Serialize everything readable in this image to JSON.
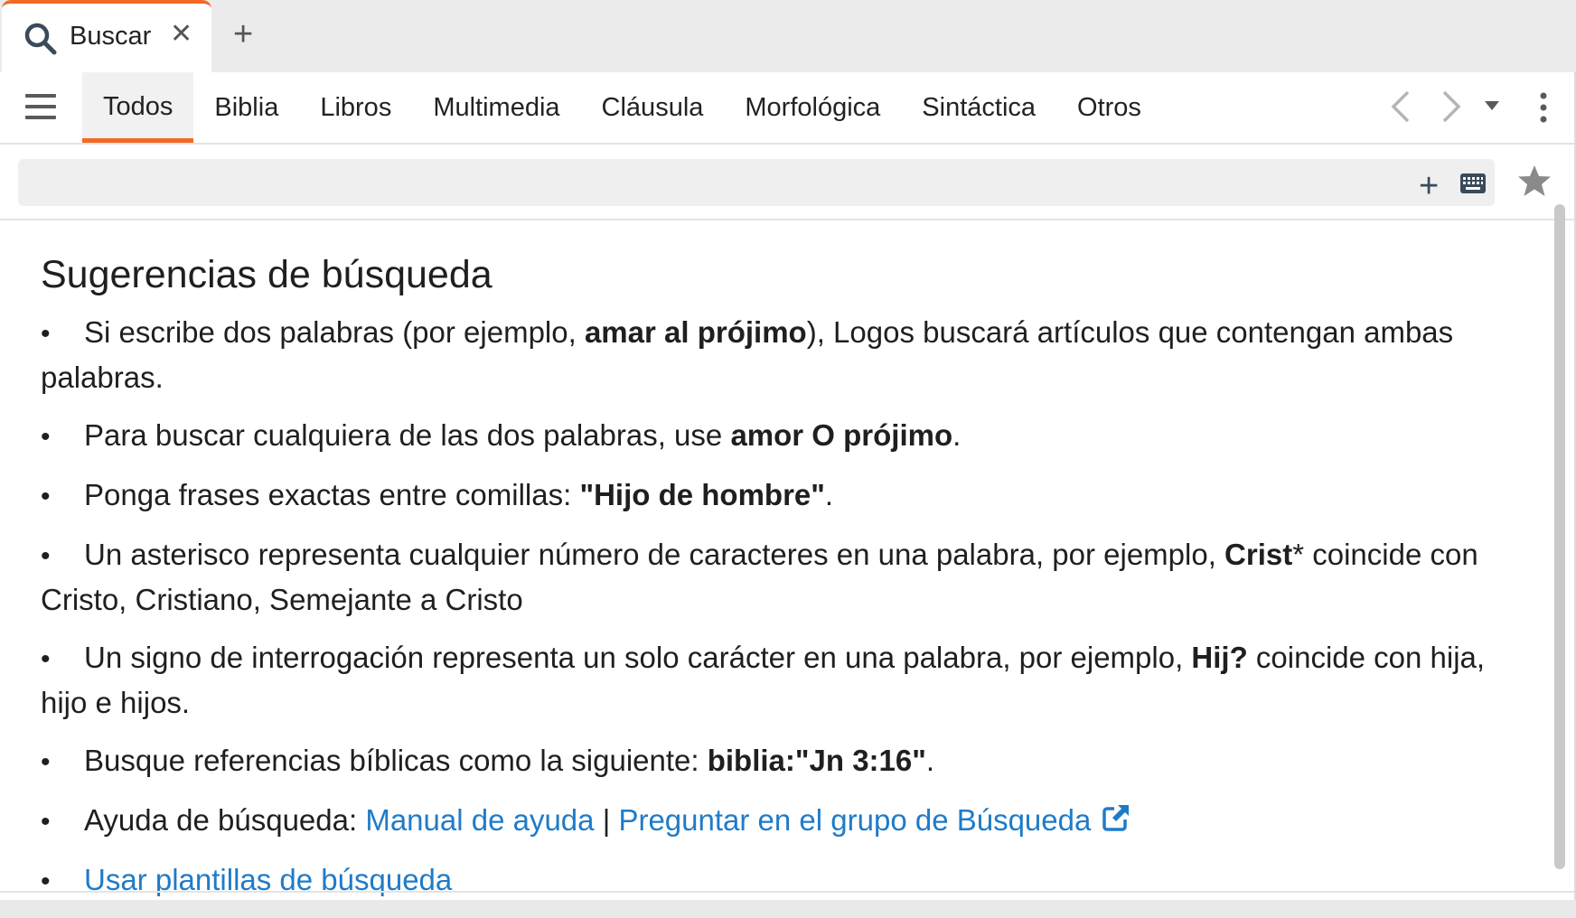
{
  "tab": {
    "title": "Buscar",
    "close": "✕",
    "new_tab": "+"
  },
  "nav": {
    "tabs": [
      {
        "label": "Todos"
      },
      {
        "label": "Biblia"
      },
      {
        "label": "Libros"
      },
      {
        "label": "Multimedia"
      },
      {
        "label": "Cláusula"
      },
      {
        "label": "Morfológica"
      },
      {
        "label": "Sintáctica"
      },
      {
        "label": "Otros"
      }
    ],
    "active_tab": "Todos"
  },
  "search": {
    "value": "",
    "add": "+"
  },
  "content": {
    "heading": "Sugerencias de búsqueda",
    "bullet": "•",
    "tip1": {
      "a": "Si escribe dos palabras (por ejemplo, ",
      "b": "amar al prójimo",
      "c": "), Logos buscará artículos que contengan ambas palabras."
    },
    "tip2": {
      "a": "Para buscar cualquiera de las dos palabras, use ",
      "b": "amor O prójimo",
      "c": "."
    },
    "tip3": {
      "a": "Ponga frases exactas entre comillas: ",
      "b": "\"Hijo de hombre\"",
      "c": "."
    },
    "tip4": {
      "a": "Un asterisco representa cualquier número de caracteres en una palabra, por ejemplo, ",
      "b": "Crist",
      "c": "* coincide con Cristo, Cristiano, Semejante a Cristo"
    },
    "tip5": {
      "a": "Un signo de interrogación representa un solo carácter en una palabra, por ejemplo, ",
      "b": "Hij?",
      "c": " coincide con hija, hijo e hijos."
    },
    "tip6": {
      "a": "Busque referencias bíblicas como la siguiente: ",
      "b": "biblia:\"Jn 3:16\"",
      "c": "."
    },
    "tip7": {
      "a": "Ayuda de búsqueda: ",
      "link1": "Manual de ayuda",
      "sep": "|",
      "link2": "Preguntar en el grupo de Búsqueda"
    },
    "tip8": {
      "link": "Usar plantillas de búsqueda"
    }
  },
  "colors": {
    "accent": "#f26a25",
    "link": "#1f7bc8"
  },
  "icons": [
    "search-icon",
    "close-icon",
    "plus-icon",
    "menu-icon",
    "chevron-left-icon",
    "chevron-right-icon",
    "caret-down-icon",
    "more-vertical-icon",
    "keyboard-icon",
    "star-icon",
    "external-link-icon"
  ]
}
